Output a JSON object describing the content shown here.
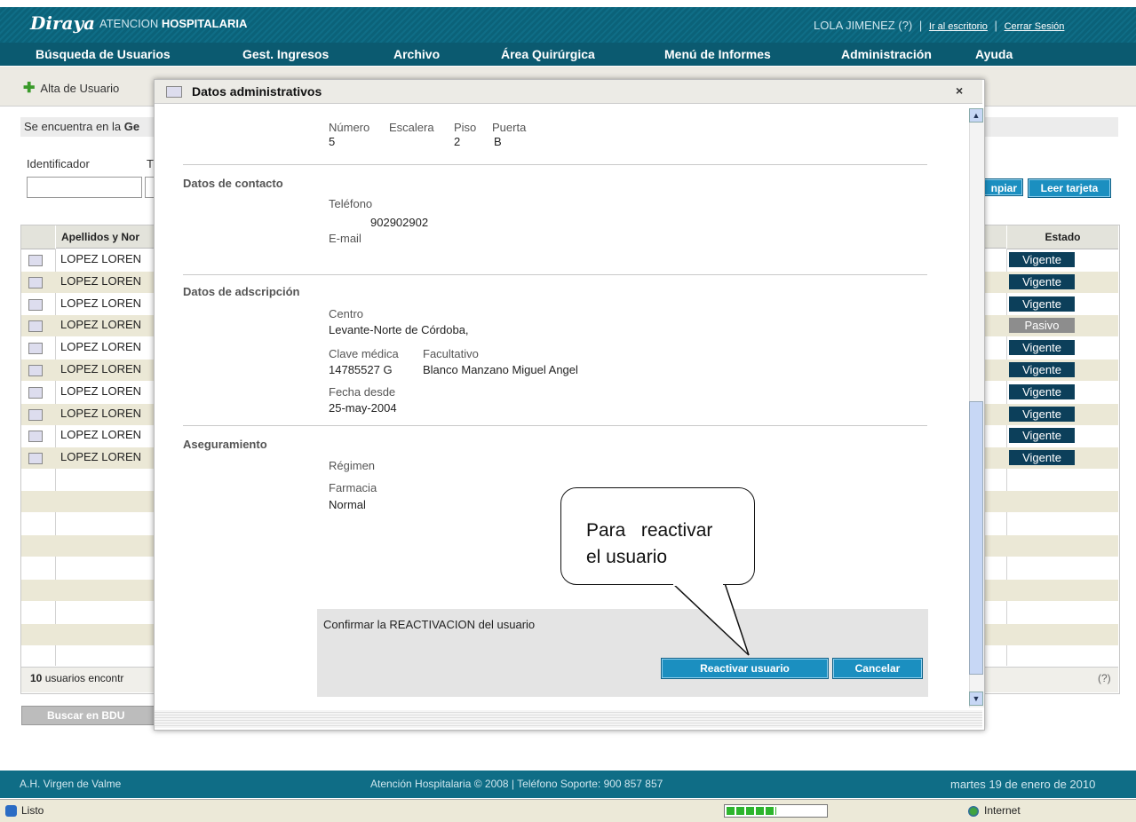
{
  "header": {
    "logo": "Diraya",
    "app_name_1": "ATENCION",
    "app_name_2": "HOSPITALARIA",
    "user": "LOLA JIMENEZ (?)",
    "sep1": "|",
    "desktop_link": "Ir al escritorio",
    "sep2": "|",
    "logout_link": "Cerrar Sesión"
  },
  "menu": [
    "Búsqueda de Usuarios",
    "Gest. Ingresos",
    "Archivo",
    "Área Quirúrgica",
    "Menú de Informes",
    "Administración",
    "Ayuda"
  ],
  "toolbar": {
    "alta": "Alta de Usuario"
  },
  "location_prefix": "Se encuentra en la",
  "location_bold": "Ge",
  "search": {
    "ident_label": "Identificador",
    "t_label": "T",
    "limpiar": "npiar",
    "leer": "Leer tarjeta"
  },
  "table": {
    "col_name": "Apellidos y Nor",
    "col_estado": "Estado",
    "rows": [
      {
        "name": "LOPEZ LOREN",
        "estado": "Vigente"
      },
      {
        "name": "LOPEZ LOREN",
        "estado": "Vigente"
      },
      {
        "name": "LOPEZ LOREN",
        "estado": "Vigente"
      },
      {
        "name": "LOPEZ LOREN",
        "estado": "Pasivo"
      },
      {
        "name": "LOPEZ LOREN",
        "estado": "Vigente"
      },
      {
        "name": "LOPEZ LOREN",
        "estado": "Vigente"
      },
      {
        "name": "LOPEZ LOREN",
        "estado": "Vigente"
      },
      {
        "name": "LOPEZ LOREN",
        "estado": "Vigente"
      },
      {
        "name": "LOPEZ LOREN",
        "estado": "Vigente"
      },
      {
        "name": "LOPEZ LOREN",
        "estado": "Vigente"
      }
    ],
    "count_bold": "10",
    "count_text": "usuarios encontr",
    "help": "(?)"
  },
  "bdu_button": "Buscar en BDU",
  "footer": {
    "hospital": "A.H. Virgen de Valme",
    "copyright": "Atención Hospitalaria © 2008 | Teléfono Soporte: 900 857 857",
    "date": "martes 19 de enero de 2010"
  },
  "statusbar": {
    "status": "Listo",
    "zone": "Internet"
  },
  "modal": {
    "title": "Datos administrativos",
    "close": "×",
    "address": {
      "numero_label": "Número",
      "escalera_label": "Escalera",
      "piso_label": "Piso",
      "puerta_label": "Puerta",
      "numero": "5",
      "piso": "2",
      "puerta": "B"
    },
    "contacto": {
      "title": "Datos de contacto",
      "telefono_label": "Teléfono",
      "telefono": "902902902",
      "email_label": "E-mail"
    },
    "adscripcion": {
      "title": "Datos de adscripción",
      "centro_label": "Centro",
      "centro": "Levante-Norte de Córdoba,",
      "clave_label": "Clave médica",
      "facultativo_label": "Facultativo",
      "clave": "14785527 G",
      "facultativo": "Blanco Manzano Miguel Angel",
      "fecha_label": "Fecha desde",
      "fecha": "25-may-2004"
    },
    "aseguramiento": {
      "title": "Aseguramiento",
      "regimen_label": "Régimen",
      "farmacia_label": "Farmacia",
      "farmacia": "Normal"
    },
    "confirm_text": "Confirmar la REACTIVACION del usuario",
    "reactivar": "Reactivar usuario",
    "cancelar": "Cancelar"
  },
  "callout": {
    "line1": "Para   reactivar",
    "line2": "el usuario"
  }
}
